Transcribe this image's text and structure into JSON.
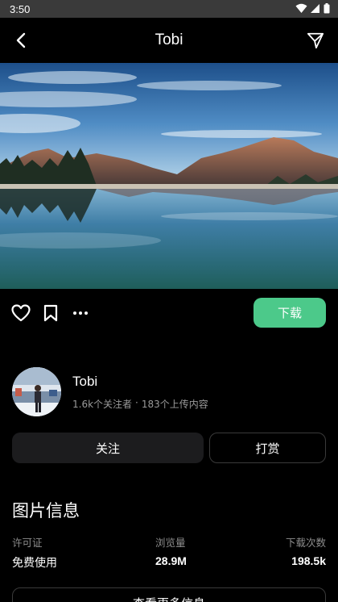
{
  "status_bar": {
    "time": "3:50"
  },
  "app_bar": {
    "title": "Tobi"
  },
  "actions": {
    "download_label": "下载"
  },
  "author": {
    "name": "Tobi",
    "followers": "1.6k个关注者",
    "separator": "·",
    "uploads": "183个上传内容"
  },
  "buttons": {
    "follow_label": "关注",
    "tip_label": "打赏"
  },
  "info": {
    "title": "图片信息",
    "license_label": "许可证",
    "license_value": "免费使用",
    "views_label": "浏览量",
    "views_value": "28.9M",
    "downloads_label": "下载次数",
    "downloads_value": "198.5k",
    "more_label": "查看更多信息"
  },
  "icons": {
    "back": "chevron-left-icon",
    "share": "send-icon",
    "like": "heart-icon",
    "bookmark": "bookmark-icon",
    "more": "more-horizontal-icon"
  },
  "colors": {
    "accent": "#4cc98a",
    "background": "#000000",
    "status_bar": "#3a3a3a",
    "secondary_text": "#9a9a9a"
  }
}
